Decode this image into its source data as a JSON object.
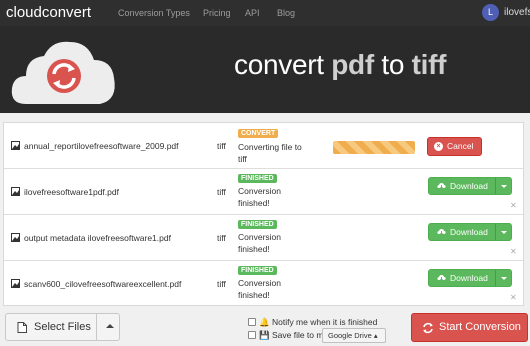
{
  "brand": {
    "logo_text": "cloudconvert"
  },
  "nav": [
    "Conversion Types",
    "Pricing",
    "API",
    "Blog"
  ],
  "user": {
    "initial": "L",
    "name": "ilovefs"
  },
  "hero": {
    "prefix": "convert",
    "from": "pdf",
    "middle": "to",
    "to": "tiff"
  },
  "files": [
    {
      "name": "annual_reportilovefreesoftware_2009.pdf",
      "ext": "tiff",
      "badge": "CONVERT",
      "status": "Converting file to tiff",
      "action": "Cancel"
    },
    {
      "name": "ilovefreesoftware1pdf.pdf",
      "ext": "tiff",
      "badge": "FINISHED",
      "status": "Conversion finished!",
      "action": "Download"
    },
    {
      "name": "output metadata ilovefreesoftware1.pdf",
      "ext": "tiff",
      "badge": "FINISHED",
      "status": "Conversion finished!",
      "action": "Download"
    },
    {
      "name": "scanv600_cilovefreesoftwareexcellent.pdf",
      "ext": "tiff",
      "badge": "FINISHED",
      "status": "Conversion finished!",
      "action": "Download"
    }
  ],
  "footer": {
    "select_label": "Select Files",
    "notify_label": "Notify me when it is finished",
    "save_label": "Save file to my",
    "storage_option": "Google Drive",
    "start_label": "Start Conversion"
  },
  "colors": {
    "topbar": "#2f2f2f",
    "hero": "#2a2a2a",
    "accent_red": "#d9534f",
    "success_green": "#5cb85c",
    "warning_orange": "#f0ad4e"
  }
}
